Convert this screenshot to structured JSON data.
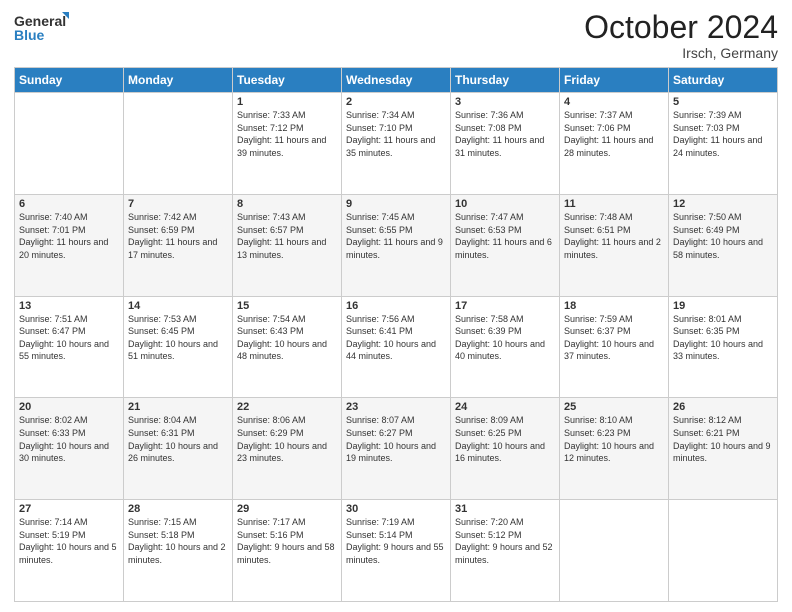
{
  "header": {
    "logo_line1": "General",
    "logo_line2": "Blue",
    "month": "October 2024",
    "location": "Irsch, Germany"
  },
  "weekdays": [
    "Sunday",
    "Monday",
    "Tuesday",
    "Wednesday",
    "Thursday",
    "Friday",
    "Saturday"
  ],
  "rows": [
    [
      {
        "day": "",
        "sunrise": "",
        "sunset": "",
        "daylight": ""
      },
      {
        "day": "",
        "sunrise": "",
        "sunset": "",
        "daylight": ""
      },
      {
        "day": "1",
        "sunrise": "Sunrise: 7:33 AM",
        "sunset": "Sunset: 7:12 PM",
        "daylight": "Daylight: 11 hours and 39 minutes."
      },
      {
        "day": "2",
        "sunrise": "Sunrise: 7:34 AM",
        "sunset": "Sunset: 7:10 PM",
        "daylight": "Daylight: 11 hours and 35 minutes."
      },
      {
        "day": "3",
        "sunrise": "Sunrise: 7:36 AM",
        "sunset": "Sunset: 7:08 PM",
        "daylight": "Daylight: 11 hours and 31 minutes."
      },
      {
        "day": "4",
        "sunrise": "Sunrise: 7:37 AM",
        "sunset": "Sunset: 7:06 PM",
        "daylight": "Daylight: 11 hours and 28 minutes."
      },
      {
        "day": "5",
        "sunrise": "Sunrise: 7:39 AM",
        "sunset": "Sunset: 7:03 PM",
        "daylight": "Daylight: 11 hours and 24 minutes."
      }
    ],
    [
      {
        "day": "6",
        "sunrise": "Sunrise: 7:40 AM",
        "sunset": "Sunset: 7:01 PM",
        "daylight": "Daylight: 11 hours and 20 minutes."
      },
      {
        "day": "7",
        "sunrise": "Sunrise: 7:42 AM",
        "sunset": "Sunset: 6:59 PM",
        "daylight": "Daylight: 11 hours and 17 minutes."
      },
      {
        "day": "8",
        "sunrise": "Sunrise: 7:43 AM",
        "sunset": "Sunset: 6:57 PM",
        "daylight": "Daylight: 11 hours and 13 minutes."
      },
      {
        "day": "9",
        "sunrise": "Sunrise: 7:45 AM",
        "sunset": "Sunset: 6:55 PM",
        "daylight": "Daylight: 11 hours and 9 minutes."
      },
      {
        "day": "10",
        "sunrise": "Sunrise: 7:47 AM",
        "sunset": "Sunset: 6:53 PM",
        "daylight": "Daylight: 11 hours and 6 minutes."
      },
      {
        "day": "11",
        "sunrise": "Sunrise: 7:48 AM",
        "sunset": "Sunset: 6:51 PM",
        "daylight": "Daylight: 11 hours and 2 minutes."
      },
      {
        "day": "12",
        "sunrise": "Sunrise: 7:50 AM",
        "sunset": "Sunset: 6:49 PM",
        "daylight": "Daylight: 10 hours and 58 minutes."
      }
    ],
    [
      {
        "day": "13",
        "sunrise": "Sunrise: 7:51 AM",
        "sunset": "Sunset: 6:47 PM",
        "daylight": "Daylight: 10 hours and 55 minutes."
      },
      {
        "day": "14",
        "sunrise": "Sunrise: 7:53 AM",
        "sunset": "Sunset: 6:45 PM",
        "daylight": "Daylight: 10 hours and 51 minutes."
      },
      {
        "day": "15",
        "sunrise": "Sunrise: 7:54 AM",
        "sunset": "Sunset: 6:43 PM",
        "daylight": "Daylight: 10 hours and 48 minutes."
      },
      {
        "day": "16",
        "sunrise": "Sunrise: 7:56 AM",
        "sunset": "Sunset: 6:41 PM",
        "daylight": "Daylight: 10 hours and 44 minutes."
      },
      {
        "day": "17",
        "sunrise": "Sunrise: 7:58 AM",
        "sunset": "Sunset: 6:39 PM",
        "daylight": "Daylight: 10 hours and 40 minutes."
      },
      {
        "day": "18",
        "sunrise": "Sunrise: 7:59 AM",
        "sunset": "Sunset: 6:37 PM",
        "daylight": "Daylight: 10 hours and 37 minutes."
      },
      {
        "day": "19",
        "sunrise": "Sunrise: 8:01 AM",
        "sunset": "Sunset: 6:35 PM",
        "daylight": "Daylight: 10 hours and 33 minutes."
      }
    ],
    [
      {
        "day": "20",
        "sunrise": "Sunrise: 8:02 AM",
        "sunset": "Sunset: 6:33 PM",
        "daylight": "Daylight: 10 hours and 30 minutes."
      },
      {
        "day": "21",
        "sunrise": "Sunrise: 8:04 AM",
        "sunset": "Sunset: 6:31 PM",
        "daylight": "Daylight: 10 hours and 26 minutes."
      },
      {
        "day": "22",
        "sunrise": "Sunrise: 8:06 AM",
        "sunset": "Sunset: 6:29 PM",
        "daylight": "Daylight: 10 hours and 23 minutes."
      },
      {
        "day": "23",
        "sunrise": "Sunrise: 8:07 AM",
        "sunset": "Sunset: 6:27 PM",
        "daylight": "Daylight: 10 hours and 19 minutes."
      },
      {
        "day": "24",
        "sunrise": "Sunrise: 8:09 AM",
        "sunset": "Sunset: 6:25 PM",
        "daylight": "Daylight: 10 hours and 16 minutes."
      },
      {
        "day": "25",
        "sunrise": "Sunrise: 8:10 AM",
        "sunset": "Sunset: 6:23 PM",
        "daylight": "Daylight: 10 hours and 12 minutes."
      },
      {
        "day": "26",
        "sunrise": "Sunrise: 8:12 AM",
        "sunset": "Sunset: 6:21 PM",
        "daylight": "Daylight: 10 hours and 9 minutes."
      }
    ],
    [
      {
        "day": "27",
        "sunrise": "Sunrise: 7:14 AM",
        "sunset": "Sunset: 5:19 PM",
        "daylight": "Daylight: 10 hours and 5 minutes."
      },
      {
        "day": "28",
        "sunrise": "Sunrise: 7:15 AM",
        "sunset": "Sunset: 5:18 PM",
        "daylight": "Daylight: 10 hours and 2 minutes."
      },
      {
        "day": "29",
        "sunrise": "Sunrise: 7:17 AM",
        "sunset": "Sunset: 5:16 PM",
        "daylight": "Daylight: 9 hours and 58 minutes."
      },
      {
        "day": "30",
        "sunrise": "Sunrise: 7:19 AM",
        "sunset": "Sunset: 5:14 PM",
        "daylight": "Daylight: 9 hours and 55 minutes."
      },
      {
        "day": "31",
        "sunrise": "Sunrise: 7:20 AM",
        "sunset": "Sunset: 5:12 PM",
        "daylight": "Daylight: 9 hours and 52 minutes."
      },
      {
        "day": "",
        "sunrise": "",
        "sunset": "",
        "daylight": ""
      },
      {
        "day": "",
        "sunrise": "",
        "sunset": "",
        "daylight": ""
      }
    ]
  ]
}
